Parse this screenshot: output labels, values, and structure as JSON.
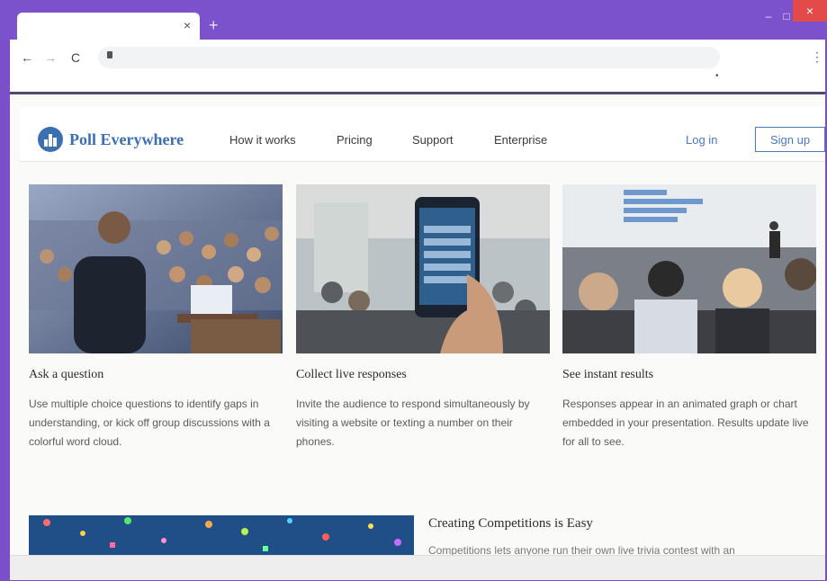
{
  "browser": {
    "tab_title": "",
    "tab_close": "×",
    "new_tab": "+",
    "minimize": "–",
    "maximize": "□",
    "close": "×",
    "url": "",
    "back": "←",
    "forward": "→",
    "reload": "C",
    "menu": "⋮",
    "bookmark_dot": "•"
  },
  "site": {
    "brand": "Poll Everywhere",
    "nav": [
      "How it works",
      "Pricing",
      "Support",
      "Enterprise"
    ],
    "login": "Log in",
    "signup": "Sign up",
    "brand_color": "#3a6fb2"
  },
  "cards": [
    {
      "title": "Ask a question",
      "description": "Use multiple choice questions to identify gaps in understanding, or kick off group discussions with a colorful word cloud."
    },
    {
      "title": "Collect live responses",
      "description": "Invite the audience to respond simultaneously by visiting a website or texting a number on their phones."
    },
    {
      "title": "See instant results",
      "description": "Responses appear in an animated graph or chart embedded in your presentation. Results update live for all to see."
    }
  ],
  "feature": {
    "title": "Creating Competitions is Easy",
    "description": "Competitions lets anyone run their own live trivia contest with an"
  },
  "icons": {
    "back": "arrow-left-icon",
    "forward": "arrow-right-icon",
    "reload": "reload-icon",
    "lock": "lock-icon",
    "menu": "kebab-menu-icon"
  }
}
